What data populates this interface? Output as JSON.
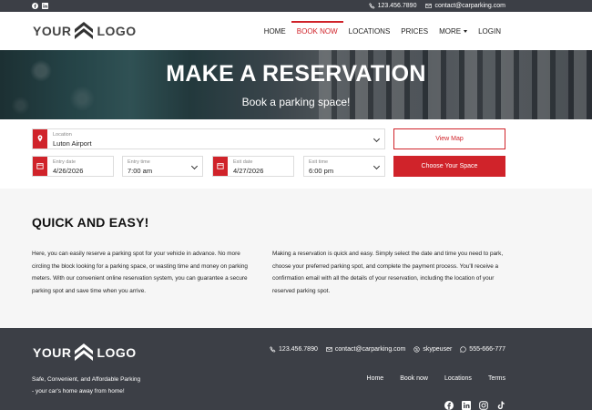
{
  "topbar": {
    "social_icons": [
      "facebook-icon",
      "linkedin-icon"
    ],
    "phone": "123.456.7890",
    "email": "contact@carparking.com"
  },
  "header": {
    "logo": {
      "left": "YOUR",
      "right": "LOGO"
    },
    "nav": [
      {
        "label": "HOME",
        "active": false
      },
      {
        "label": "BOOK NOW",
        "active": true
      },
      {
        "label": "LOCATIONS",
        "active": false
      },
      {
        "label": "PRICES",
        "active": false
      },
      {
        "label": "MORE",
        "active": false,
        "dropdown": true
      },
      {
        "label": "LOGIN",
        "active": false
      }
    ]
  },
  "hero": {
    "title": "MAKE A RESERVATION",
    "subtitle": "Book a parking space!"
  },
  "form": {
    "location": {
      "label": "Location",
      "value": "Luton Airport",
      "icon": "location-pin-icon"
    },
    "entry_date": {
      "label": "Entry date",
      "value": "4/26/2026",
      "icon": "calendar-icon"
    },
    "entry_time": {
      "label": "Entry time",
      "value": "7:00 am"
    },
    "exit_date": {
      "label": "Exit date",
      "value": "4/27/2026",
      "icon": "calendar-icon"
    },
    "exit_time": {
      "label": "Exit time",
      "value": "6:00 pm"
    },
    "view_map_label": "View Map",
    "choose_label": "Choose Your Space"
  },
  "info": {
    "title": "QUICK AND EASY!",
    "left_text": "Here, you can easily reserve a parking spot for your vehicle in advance. No more circling the block looking for a parking space, or wasting time and money on parking meters. With our convenient online reservation system, you can guarantee a secure parking spot and save time when you arrive.",
    "right_text": "Making a reservation is quick and easy. Simply select the date and time you need to park, choose your preferred parking spot, and complete the payment process. You'll receive a confirmation email with all the details of your reservation, including the location of your reserved parking spot."
  },
  "footer": {
    "logo": {
      "left": "YOUR",
      "right": "LOGO"
    },
    "tagline_1": "Safe, Convenient, and Affordable Parking",
    "tagline_2": "- your car's home away from home!",
    "phone": "123.456.7890",
    "email": "contact@carparking.com",
    "skype": "skypeuser",
    "whatsapp": "555-666-777",
    "links": [
      "Home",
      "Book now",
      "Locations",
      "Terms"
    ],
    "social_icons": [
      "facebook-icon",
      "linkedin-icon",
      "instagram-icon",
      "tiktok-icon"
    ]
  },
  "colors": {
    "accent": "#d0232a",
    "dark": "#3c3f46",
    "light_bg": "#f6f6f6"
  }
}
